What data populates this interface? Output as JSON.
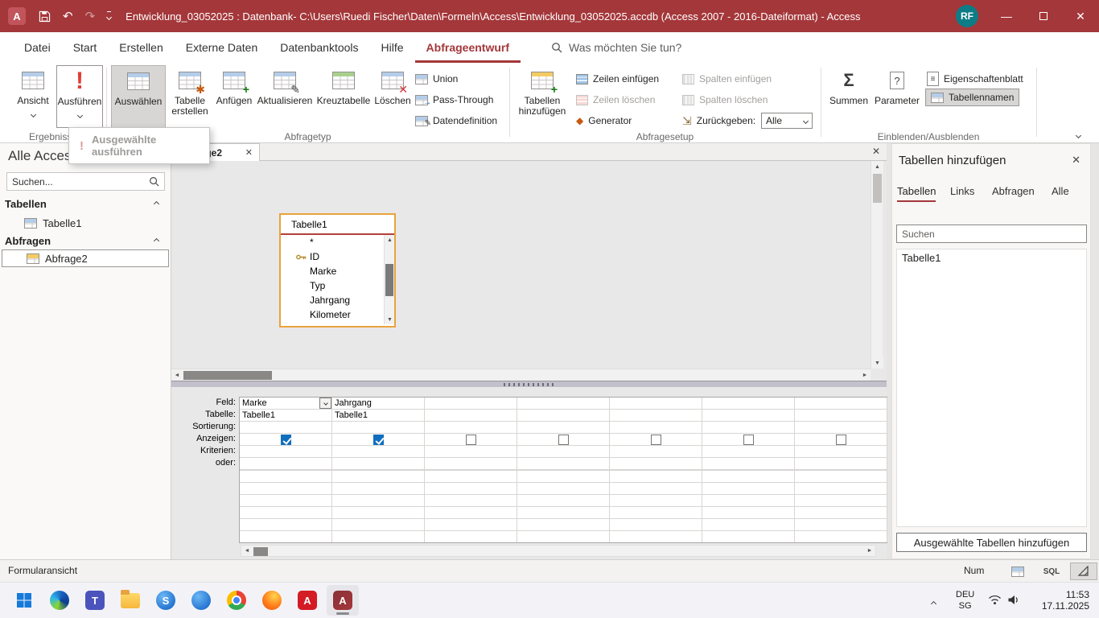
{
  "colors": {
    "accent": "#A4373A",
    "checkbox_checked": "#106EBE",
    "field_card_border": "#E8A33D",
    "titlebar": "#A4373A"
  },
  "titlebar": {
    "title": "Entwicklung_03052025 : Datenbank- C:\\Users\\Ruedi Fischer\\Daten\\Formeln\\Access\\Entwicklung_03052025.accdb (Access 2007 - 2016-Dateiformat)  -  Access",
    "avatar": "RF"
  },
  "ribbon": {
    "tabs": [
      {
        "label": "Datei"
      },
      {
        "label": "Start"
      },
      {
        "label": "Erstellen"
      },
      {
        "label": "Externe Daten"
      },
      {
        "label": "Datenbanktools"
      },
      {
        "label": "Hilfe"
      },
      {
        "label": "Abfrageentwurf",
        "active": true
      }
    ],
    "search_placeholder": "Was möchten Sie tun?",
    "groups": {
      "ergebnisse": {
        "label": "Ergebnisse",
        "view": "Ansicht",
        "run": "Ausführen"
      },
      "abfragetyp": {
        "label": "Abfragetyp",
        "select": "Auswählen",
        "make_table": "Tabelle erstellen",
        "append": "Anfügen",
        "update": "Aktualisieren",
        "crosstab": "Kreuztabelle",
        "delete": "Löschen",
        "union": "Union",
        "pass_through": "Pass-Through",
        "data_definition": "Datendefinition"
      },
      "abfragesetup": {
        "label": "Abfragesetup",
        "add_tables": "Tabellen hinzufügen",
        "insert_rows": "Zeilen einfügen",
        "delete_rows": "Zeilen löschen",
        "builder": "Generator",
        "insert_columns": "Spalten einfügen",
        "delete_columns": "Spalten löschen",
        "return_label": "Zurückgeben:",
        "return_value": "Alle"
      },
      "einblenden": {
        "label": "Einblenden/Ausblenden",
        "totals": "Summen",
        "parameters": "Parameter",
        "property_sheet": "Eigenschaftenblatt",
        "table_names": "Tabellennamen"
      }
    }
  },
  "run_menu": {
    "items": [
      {
        "label": "Ausgewählte ausführen",
        "disabled": true
      }
    ]
  },
  "nav": {
    "title": "Alle Access-Objekte",
    "search_placeholder": "Suchen...",
    "sections": [
      {
        "label": "Tabellen",
        "items": [
          {
            "label": "Tabelle1"
          }
        ]
      },
      {
        "label": "Abfragen",
        "items": [
          {
            "label": "Abfrage2",
            "selected": true
          }
        ]
      }
    ]
  },
  "document": {
    "tab_title": "Abfrage2",
    "field_list": {
      "title": "Tabelle1",
      "fields": [
        "*",
        "ID",
        "Marke",
        "Typ",
        "Jahrgang",
        "Kilometer"
      ],
      "key_field": "ID"
    },
    "grid": {
      "row_labels": [
        "Feld:",
        "Tabelle:",
        "Sortierung:",
        "Anzeigen:",
        "Kriterien:",
        "oder:"
      ],
      "columns": [
        {
          "feld": "Marke",
          "tabelle": "Tabelle1",
          "anzeigen": true
        },
        {
          "feld": "Jahrgang",
          "tabelle": "Tabelle1",
          "anzeigen": true
        },
        {
          "feld": "",
          "tabelle": "",
          "anzeigen": false
        },
        {
          "feld": "",
          "tabelle": "",
          "anzeigen": false
        },
        {
          "feld": "",
          "tabelle": "",
          "anzeigen": false
        },
        {
          "feld": "",
          "tabelle": "",
          "anzeigen": false
        },
        {
          "feld": "",
          "tabelle": "",
          "anzeigen": false
        }
      ]
    }
  },
  "add_tables_panel": {
    "title": "Tabellen hinzufügen",
    "tabs": [
      {
        "label": "Tabellen",
        "active": true
      },
      {
        "label": "Links"
      },
      {
        "label": "Abfragen"
      },
      {
        "label": "Alle"
      }
    ],
    "search_placeholder": "Suchen",
    "items": [
      {
        "label": "Tabelle1"
      }
    ],
    "add_button": "Ausgewählte Tabellen hinzufügen"
  },
  "statusbar": {
    "view_name": "Formularansicht",
    "num_lock": "Num",
    "sql_label": "SQL"
  },
  "taskbar": {
    "language": {
      "line1": "DEU",
      "line2": "SG"
    },
    "clock": {
      "time": "11:53",
      "date": "17.11.2025"
    }
  }
}
